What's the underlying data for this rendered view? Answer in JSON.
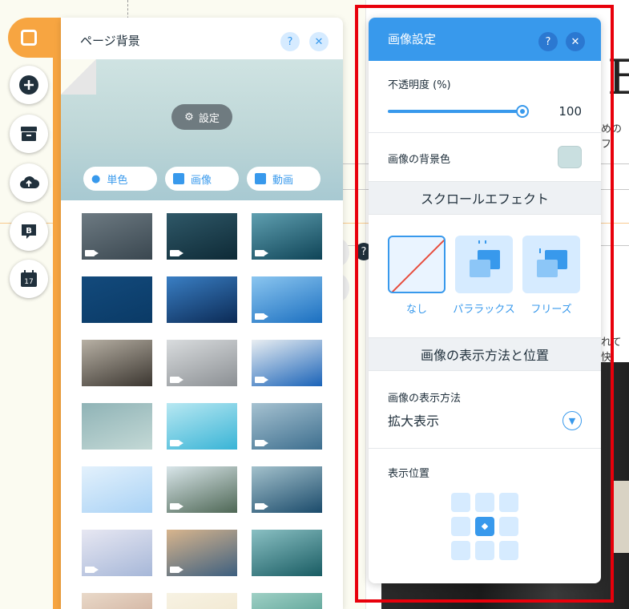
{
  "toolbar": {
    "items": [
      {
        "name": "background",
        "icon": "page-square-icon",
        "active": true
      },
      {
        "name": "add",
        "icon": "plus-circle-icon"
      },
      {
        "name": "app-market",
        "icon": "store-icon"
      },
      {
        "name": "upload",
        "icon": "cloud-upload-icon"
      },
      {
        "name": "blog",
        "icon": "blog-b-icon"
      },
      {
        "name": "bookings",
        "icon": "calendar-icon",
        "badge": "17"
      }
    ],
    "accent": "#f7a541"
  },
  "bg_panel": {
    "title": "ページ背景",
    "help_label": "?",
    "close_label": "✕",
    "settings_label": "設定",
    "types": [
      {
        "label": "単色",
        "icon": "drop-icon"
      },
      {
        "label": "画像",
        "icon": "image-icon"
      },
      {
        "label": "動画",
        "icon": "video-icon"
      }
    ],
    "thumbnails": [
      {
        "name": "storm-clouds",
        "video": true,
        "colors": [
          "#3a4750",
          "#6d7a82"
        ]
      },
      {
        "name": "dark-water",
        "video": true,
        "colors": [
          "#0e2a36",
          "#2f5868"
        ]
      },
      {
        "name": "underwater-ice",
        "video": true,
        "colors": [
          "#0f4457",
          "#5f9fb0"
        ]
      },
      {
        "name": "blue-dots",
        "video": false,
        "colors": [
          "#0a3a66",
          "#134a7c"
        ]
      },
      {
        "name": "jellyfish",
        "video": false,
        "colors": [
          "#0b2a55",
          "#3a7fc4"
        ]
      },
      {
        "name": "palm-trees",
        "video": true,
        "colors": [
          "#1b6fc0",
          "#8bc6f0"
        ]
      },
      {
        "name": "cafe-sign",
        "video": false,
        "colors": [
          "#3b3630",
          "#b7b0a4"
        ]
      },
      {
        "name": "laptop",
        "video": true,
        "colors": [
          "#8b8f93",
          "#d9dcde"
        ]
      },
      {
        "name": "snowboarder",
        "video": true,
        "colors": [
          "#1a63b8",
          "#e9eef2"
        ]
      },
      {
        "name": "misty-sea",
        "video": false,
        "colors": [
          "#c4d9d6",
          "#8fb3b6"
        ]
      },
      {
        "name": "water-drop",
        "video": true,
        "colors": [
          "#39b4d6",
          "#b8e8f2"
        ]
      },
      {
        "name": "blue-ink",
        "video": true,
        "colors": [
          "#3d6e8e",
          "#a6c2d1"
        ]
      },
      {
        "name": "blue-gingham",
        "video": false,
        "colors": [
          "#a9d2f5",
          "#e3f1fc"
        ]
      },
      {
        "name": "mountain-sun",
        "video": true,
        "colors": [
          "#4e6755",
          "#d9e6ea"
        ]
      },
      {
        "name": "snow-mountains",
        "video": true,
        "colors": [
          "#1b4b6b",
          "#a3c1cc"
        ]
      },
      {
        "name": "bokeh",
        "video": true,
        "colors": [
          "#a6b7d8",
          "#e7e7f2"
        ]
      },
      {
        "name": "beach-sunset",
        "video": true,
        "colors": [
          "#3d5f7f",
          "#d8b58d"
        ]
      },
      {
        "name": "teal-ocean",
        "video": false,
        "colors": [
          "#195c63",
          "#8ac0c3"
        ]
      },
      {
        "name": "dusk-mountains",
        "video": false,
        "colors": [
          "#c8a38f",
          "#e9d9c9"
        ]
      },
      {
        "name": "pale-sand",
        "video": false,
        "colors": [
          "#efe4c9",
          "#f7f2e3"
        ]
      },
      {
        "name": "green-sea",
        "video": false,
        "colors": [
          "#3f8f83",
          "#9fd0c5"
        ]
      }
    ]
  },
  "image_settings": {
    "title": "画像設定",
    "help_label": "?",
    "close_label": "✕",
    "opacity_label": "不透明度 (%)",
    "opacity_value": "100",
    "opacity_fraction": 1.0,
    "bg_color_label": "画像の背景色",
    "bg_color": "#c9dfe0",
    "scroll_section": "スクロールエフェクト",
    "effects": [
      {
        "label": "なし",
        "icon": "none-slash-icon",
        "selected": true
      },
      {
        "label": "パララックス",
        "icon": "parallax-icon",
        "selected": false
      },
      {
        "label": "フリーズ",
        "icon": "freeze-icon",
        "selected": false
      }
    ],
    "display_section": "画像の表示方法と位置",
    "display_mode_label": "画像の表示方法",
    "display_mode_value": "拡大表示",
    "position_label": "表示位置",
    "position_selected": "center"
  },
  "canvas": {
    "heading_fragment": "E",
    "text_fragment_1": "めのフ",
    "text_fragment_2": "れて快"
  }
}
